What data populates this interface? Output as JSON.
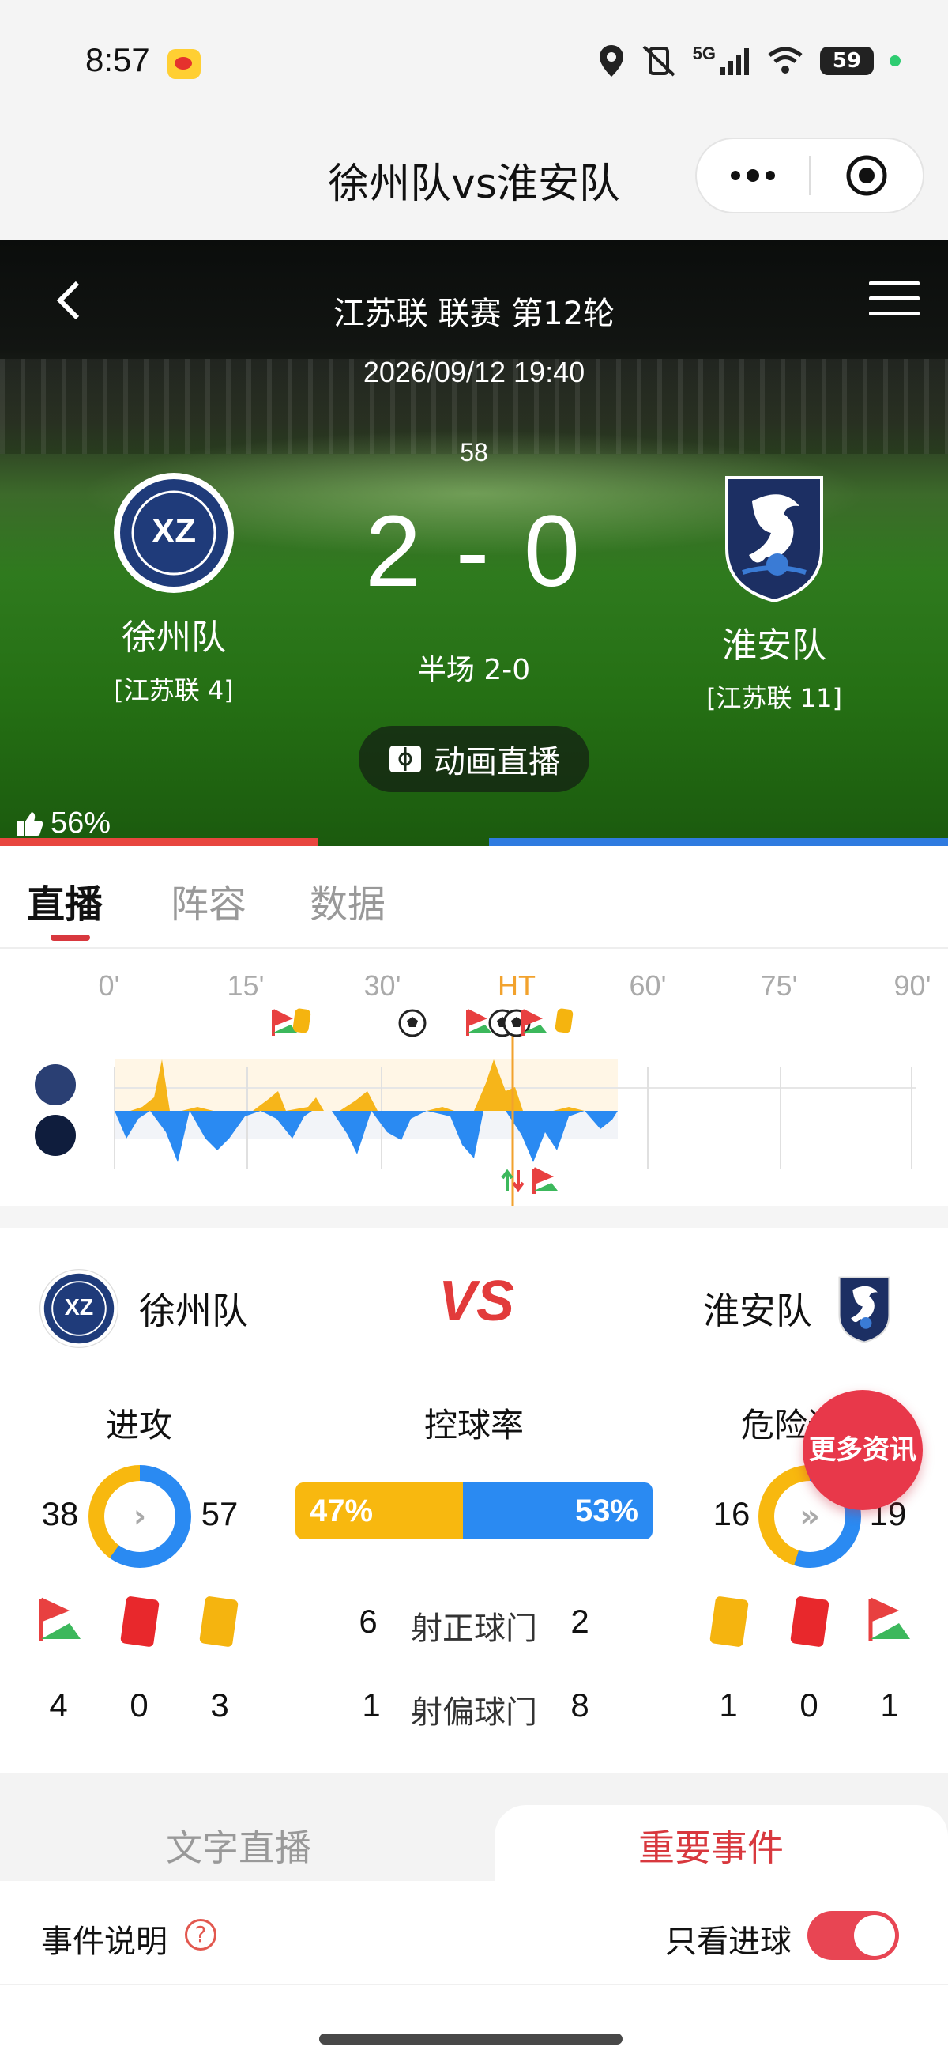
{
  "status_bar": {
    "time": "8:57",
    "network": "5G",
    "battery": "59"
  },
  "title_bar": {
    "title": "徐州队vs淮安队"
  },
  "match": {
    "league_round": "江苏联 联赛 第12轮",
    "datetime": "2026/09/12 19:40",
    "minute": "58",
    "score": "2 - 0",
    "halftime": "半场 2-0",
    "animation_button": "动画直播",
    "home": {
      "name": "徐州队",
      "rank": "[江苏联 4]",
      "crest_text": "XZ"
    },
    "away": {
      "name": "淮安队",
      "rank": "[江苏联 11]"
    },
    "support": {
      "home_percent": "56%",
      "home_share": 0.56
    }
  },
  "tabs": [
    "直播",
    "阵容",
    "数据"
  ],
  "timeline": {
    "labels": [
      "0'",
      "15'",
      "30'",
      "HT",
      "60'",
      "75'",
      "90'"
    ],
    "current_minute": 58
  },
  "stats": {
    "home_team": "徐州队",
    "away_team": "淮安队",
    "vs": "VS",
    "attack": {
      "label": "进攻",
      "home": "38",
      "away": "57"
    },
    "possession": {
      "label": "控球率",
      "home": "47%",
      "away": "53%",
      "home_share": 0.47
    },
    "danger": {
      "label": "危险进攻",
      "home": "16",
      "away": "19"
    },
    "cards_corners": {
      "home": {
        "corners": "4",
        "red": "0",
        "yellow": "3"
      },
      "away": {
        "yellow": "1",
        "red": "0",
        "corners": "1"
      }
    },
    "shots_on_target": {
      "label": "射正球门",
      "home": "6",
      "away": "2"
    },
    "shots_off_target": {
      "label": "射偏球门",
      "home": "1",
      "away": "8"
    },
    "more_info": "更多资讯"
  },
  "bottom_tabs": {
    "text_live": "文字直播",
    "key_events": "重要事件"
  },
  "filter": {
    "event_desc": "事件说明",
    "help": "?",
    "only_goals": "只看进球",
    "only_goals_on": true
  },
  "colors": {
    "home_red": "#e8463f",
    "away_blue": "#2f7be0",
    "possession_home": "#f8b80f",
    "possession_away": "#2a8af2",
    "accent": "#d8383e"
  }
}
